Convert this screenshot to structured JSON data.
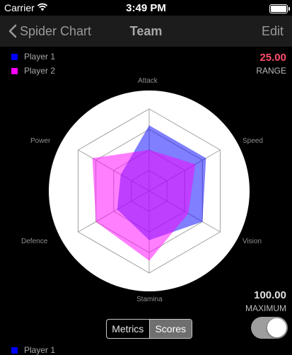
{
  "status_bar": {
    "carrier": "Carrier",
    "time": "3:49 PM"
  },
  "nav": {
    "back_label": "Spider Chart",
    "title": "Team",
    "edit_label": "Edit"
  },
  "stats": {
    "range_value": "25.00",
    "range_label": "RANGE",
    "range_color": "#ff4d6a",
    "maximum_value": "100.00",
    "maximum_label": "MAXIMUM",
    "maximum_color": "#e0e0e0"
  },
  "segmented": {
    "options": [
      "Metrics",
      "Scores"
    ],
    "selected": "Scores"
  },
  "toggle": {
    "on": true
  },
  "bottom_legend": {
    "label": "Player 1"
  },
  "chart_data": {
    "type": "radar",
    "axes": [
      "Attack",
      "Speed",
      "Vision",
      "Stamina",
      "Defence",
      "Power"
    ],
    "max": 100,
    "rings": 4,
    "series": [
      {
        "name": "Player 1",
        "color": "#0000ff",
        "values": [
          80,
          80,
          75,
          60,
          45,
          40
        ]
      },
      {
        "name": "Player 2",
        "color": "#ff00ff",
        "values": [
          50,
          65,
          55,
          85,
          75,
          80
        ]
      }
    ]
  }
}
